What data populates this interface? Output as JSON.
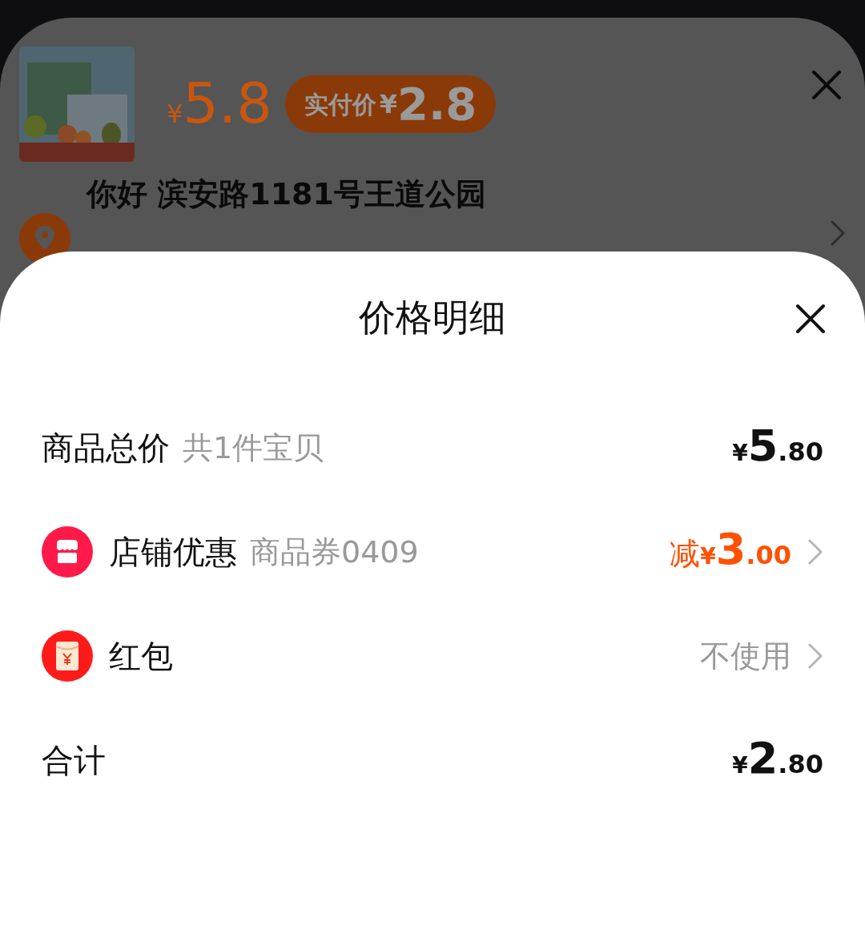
{
  "back_sheet": {
    "price": {
      "symbol": "¥",
      "amount": "5.8"
    },
    "paid_badge": {
      "label": "实付价",
      "symbol": "¥",
      "amount": "2.8"
    },
    "address": "你好 滨安路1181号王道公园"
  },
  "sheet": {
    "title": "价格明细",
    "rows": [
      {
        "kind": "plain",
        "label": "商品总价",
        "note": "共1件宝贝",
        "prefix": "",
        "symbol": "¥",
        "integer": "5",
        "decimal": ".80",
        "highlight": false
      },
      {
        "kind": "shop",
        "label": "店铺优惠",
        "note": "商品券0409",
        "prefix": "减",
        "symbol": "¥",
        "integer": "3",
        "decimal": ".00",
        "highlight": true
      },
      {
        "kind": "redpacket",
        "label": "红包",
        "value": "不使用"
      },
      {
        "kind": "plain",
        "label": "合计",
        "note": "",
        "prefix": "",
        "symbol": "¥",
        "integer": "2",
        "decimal": ".80",
        "highlight": false
      }
    ]
  }
}
